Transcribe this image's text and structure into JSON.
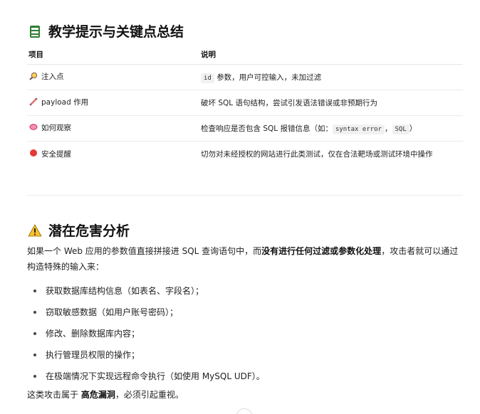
{
  "section1": {
    "icon": "clipboard-icon",
    "title": "教学提示与关键点总结"
  },
  "table": {
    "headers": [
      "项目",
      "说明"
    ],
    "rows": [
      {
        "icon": "magnifier-icon",
        "item": "注入点",
        "code1": "id",
        "desc": "参数，用户可控输入，未加过滤"
      },
      {
        "icon": "syringe-icon",
        "item": "payload 作用",
        "desc": "破坏 SQL 语句结构，尝试引发语法错误或非预期行为"
      },
      {
        "icon": "speech-bubble-icon",
        "item": "如何观察",
        "desc_prefix": "检查响应是否包含 SQL 报错信息（如：",
        "code1": "syntax error",
        "sep": "，",
        "code2": "SQL",
        "desc_suffix": "）"
      },
      {
        "icon": "red-circle-icon",
        "item": "安全提醒",
        "desc": "切勿对未经授权的网站进行此类测试，仅在合法靶场或测试环境中操作"
      }
    ]
  },
  "section2": {
    "icon": "warning-icon",
    "title": "潜在危害分析",
    "intro_a": "如果一个 Web 应用的参数值直接拼接进 SQL 查询语句中，而",
    "intro_bold": "没有进行任何过滤或参数化处理",
    "intro_b": "，攻击者就可以通过构造特殊的输入来：",
    "bullets": [
      "获取数据库结构信息（如表名、字段名）；",
      "窃取敏感数据（如用户账号密码）；",
      "修改、删除数据库内容；",
      "执行管理员权限的操作；",
      "在极端情况下实现远程命令执行（如使用 MySQL UDF）。"
    ],
    "outro_a": "这类攻击属于 ",
    "outro_bold": "高危漏洞",
    "outro_b": "，必须引起重视。"
  },
  "colors": {
    "heading": "#111111",
    "text": "#1f1f1f",
    "code_bg": "#f1f1f1",
    "divider": "#ededed"
  }
}
